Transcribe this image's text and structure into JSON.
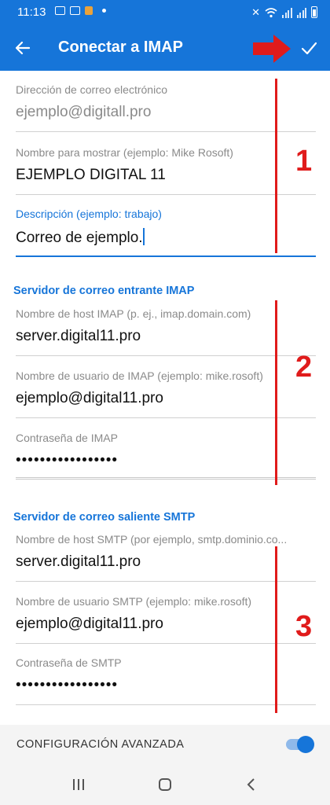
{
  "status_bar": {
    "time": "11:13"
  },
  "app_bar": {
    "title": "Conectar a IMAP"
  },
  "account": {
    "email_label": "Dirección de correo electrónico",
    "email_value": "ejemplo@digitall.pro",
    "display_name_label": "Nombre para mostrar (ejemplo: Mike Rosoft)",
    "display_name_value": "EJEMPLO DIGITAL 11",
    "description_label": "Descripción (ejemplo: trabajo)",
    "description_value": "Correo de ejemplo."
  },
  "imap": {
    "header": "Servidor de correo entrante IMAP",
    "host_label": "Nombre de host IMAP (p. ej., imap.domain.com)",
    "host_value": "server.digital11.pro",
    "user_label": "Nombre de usuario de IMAP (ejemplo: mike.rosoft)",
    "user_value": "ejemplo@digital11.pro",
    "password_label": "Contraseña de IMAP",
    "password_value": "•••••••••••••••••"
  },
  "smtp": {
    "header": "Servidor de correo saliente SMTP",
    "host_label": "Nombre de host SMTP (por ejemplo, smtp.dominio.co...",
    "host_value": "server.digital11.pro",
    "user_label": "Nombre de usuario SMTP (ejemplo: mike.rosoft)",
    "user_value": "ejemplo@digital11.pro",
    "password_label": "Contraseña de SMTP",
    "password_value": "•••••••••••••••••"
  },
  "annotations": {
    "one": "1",
    "two": "2",
    "three": "3"
  },
  "advanced": {
    "label": "CONFIGURACIÓN AVANZADA",
    "enabled": true
  },
  "colors": {
    "primary": "#1675d9",
    "annotation": "#e01b1b",
    "label": "#8a8a8a"
  }
}
